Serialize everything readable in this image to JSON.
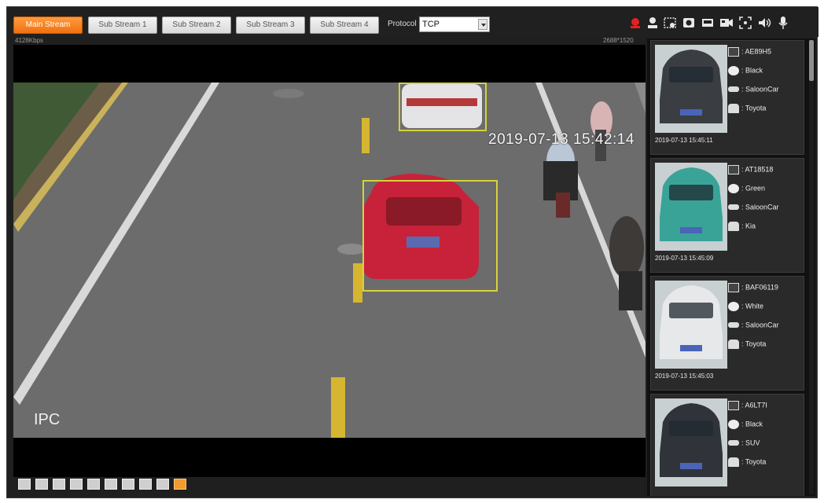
{
  "toolbar": {
    "streams": [
      {
        "label": "Main Stream",
        "active": true
      },
      {
        "label": "Sub Stream 1",
        "active": false
      },
      {
        "label": "Sub Stream 2",
        "active": false
      },
      {
        "label": "Sub Stream 3",
        "active": false
      },
      {
        "label": "Sub Stream 4",
        "active": false
      }
    ],
    "protocol_label": "Protocol",
    "protocol_value": "TCP",
    "right_icons": [
      "alarm-icon",
      "user-icon",
      "snapshot-area-icon",
      "record-icon",
      "screenshot-icon",
      "video-record-icon",
      "fullscreen-icon",
      "audio-icon",
      "microphone-icon"
    ]
  },
  "stats": {
    "bitrate": "4128Kbps",
    "resolution": "2688*1520"
  },
  "video": {
    "timestamp": "2019-07-13 15:42:14",
    "ipc_label": "IPC"
  },
  "bottom_tools": [
    "image-adjust-icon",
    "original-size-icon",
    "fullscreen-icon",
    "width-height-ratio-icon",
    "fluency-icon",
    "rules-icon",
    "zoom-icon",
    "focus-icon",
    "ptz-icon",
    "intelligent-overlay-icon"
  ],
  "colors": {
    "accent": "#f07010",
    "box": "#d7d23a",
    "panel": "#2a2a2a"
  },
  "cards": [
    {
      "plate": ": AE89H5",
      "color": ": Black",
      "type": ": SaloonCar",
      "brand": ": Toyota",
      "time": "2019-07-13 15:45:11",
      "car_color": "#3a3d42"
    },
    {
      "plate": ": AT18518",
      "color": ": Green",
      "type": ": SaloonCar",
      "brand": ": Kia",
      "time": "2019-07-13 15:45:09",
      "car_color": "#3aa398"
    },
    {
      "plate": ": BAF06119",
      "color": ": White",
      "type": ": SaloonCar",
      "brand": ": Toyota",
      "time": "2019-07-13 15:45:03",
      "car_color": "#e6e8ea"
    },
    {
      "plate": ": A6LT7I",
      "color": ": Black",
      "type": ": SUV",
      "brand": ": Toyota",
      "time": "",
      "car_color": "#30343a"
    }
  ]
}
